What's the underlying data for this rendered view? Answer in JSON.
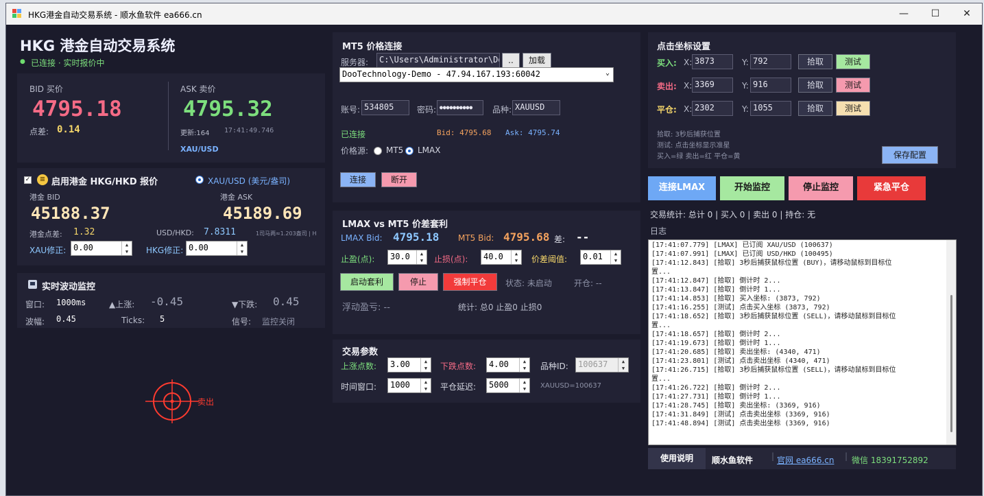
{
  "window": {
    "title": "HKG港金自动交易系统 - 顺水鱼软件 ea666.cn",
    "buttons": [
      "—",
      "☐",
      "✕"
    ]
  },
  "header": {
    "title": "HKG 港金自动交易系统",
    "status": "已连接 · 实时报价中"
  },
  "quote": {
    "bid_label": "BID 买价",
    "bid": "4795.18",
    "ask_label": "ASK 卖价",
    "ask": "4795.32",
    "spread_label": "点差:",
    "spread": "0.14",
    "update_label": "更新:164",
    "time": "17:41:49.746",
    "symbol": "XAU/USD"
  },
  "hkg": {
    "enable_label": "启用港金 HKG/HKD 报价",
    "radio_label": "XAU/USD (美元/盎司)",
    "bid_label": "港金 BID",
    "bid": "45188.37",
    "ask_label": "港金 ASK",
    "ask": "45189.69",
    "spread_label": "港金点差:",
    "spread": "1.32",
    "rate_label": "USD/HKD:",
    "rate": "7.8311",
    "rate_note": "1司马两≈1.203盎司 | H",
    "xau_adj_label": "XAU修正:",
    "xau_adj": "0.00",
    "hkg_adj_label": "HKG修正:",
    "hkg_adj": "0.00"
  },
  "monitor": {
    "title": "实时波动监控",
    "window_label": "窗口:",
    "window": "1000ms",
    "up_label": "▲上涨:",
    "up": "-0.45",
    "down_label": "▼下跌:",
    "down": "0.45",
    "amp_label": "波幅:",
    "amp": "0.45",
    "ticks_label": "Ticks:",
    "ticks": "5",
    "signal_label": "信号:",
    "signal": "监控关闭"
  },
  "crosshair": {
    "label": "卖出"
  },
  "mt5": {
    "title": "MT5 价格连接",
    "server_label": "服务器:",
    "server_path": "C:\\Users\\Administrator\\Do",
    "browse": "..",
    "load": "加载",
    "server_select": "DooTechnology-Demo - 47.94.167.193:60042",
    "account_label": "账号:",
    "account": "534805",
    "password_label": "密码:",
    "password": "●●●●●●●●●●",
    "symbol_label": "品种:",
    "symbol": "XAUUSD",
    "status": "已连接",
    "bid_text": "Bid: 4795.68",
    "ask_text": "Ask: 4795.74",
    "source_label": "价格源:",
    "source_mt5": "MT5",
    "source_lmax": "LMAX",
    "connect": "连接",
    "disconnect": "断开"
  },
  "arb": {
    "title": "LMAX vs MT5 价差套利",
    "lmax_bid_label": "LMAX Bid:",
    "lmax_bid": "4795.18",
    "mt5_bid_label": "MT5 Bid:",
    "mt5_bid": "4795.68",
    "diff_label": "差:",
    "diff": "--",
    "tp_label": "止盈(点):",
    "tp": "30.0",
    "sl_label": "止损(点):",
    "sl": "40.0",
    "threshold_label": "价差阈值:",
    "threshold": "0.01",
    "start": "启动套利",
    "stop": "停止",
    "force_close": "强制平仓",
    "state": "状态: 未启动",
    "open": "开仓: --",
    "pnl": "浮动盈亏: --",
    "stats": "统计: 总0 止盈0 止损0"
  },
  "params": {
    "title": "交易参数",
    "up_pts_label": "上涨点数:",
    "up_pts": "3.00",
    "down_pts_label": "下跌点数:",
    "down_pts": "4.00",
    "symbol_id_label": "品种ID:",
    "symbol_id": "100637",
    "time_window_label": "时间窗口:",
    "time_window": "1000",
    "close_delay_label": "平仓延迟:",
    "close_delay": "5000",
    "symbol_note": "XAUUSD=100637"
  },
  "coords": {
    "title": "点击坐标设置",
    "rows": [
      {
        "label": "买入:",
        "x": "3873",
        "y": "792",
        "pick": "拾取",
        "test": "测试",
        "color": "#a6e8a0"
      },
      {
        "label": "卖出:",
        "x": "3369",
        "y": "916",
        "pick": "拾取",
        "test": "测试",
        "color": "#f59aae"
      },
      {
        "label": "平仓:",
        "x": "2302",
        "y": "1055",
        "pick": "拾取",
        "test": "测试",
        "color": "#f5dfb0"
      }
    ],
    "x_label": "X:",
    "y_label": "Y:",
    "note1": "拾取: 3秒后捕获位置",
    "note2": "测试: 点击坐标显示准星",
    "note3": "买入=绿 卖出=红 平仓=黄",
    "save": "保存配置"
  },
  "actions": {
    "connect_lmax": "连接LMAX",
    "start_monitor": "开始监控",
    "stop_monitor": "停止监控",
    "emergency_close": "紧急平仓"
  },
  "stats_line": "交易统计: 总计 0 | 买入 0 | 卖出 0 | 持仓: 无",
  "log_title": "日志",
  "log": [
    "[17:41:07.779] [LMAX] 已订阅 XAU/USD (100637)",
    "[17:41:07.991] [LMAX] 已订阅 USD/HKD (100495)",
    "[17:41:12.843] [拾取] 3秒后捕获鼠标位置 (BUY)，请移动鼠标到目标位",
    "置...",
    "[17:41:12.847] [拾取] 倒计时 2...",
    "[17:41:13.847] [拾取] 倒计时 1...",
    "[17:41:14.853] [拾取] 买入坐标: (3873, 792)",
    "[17:41:16.255] [测试] 点击买入坐标 (3873, 792)",
    "[17:41:18.652] [拾取] 3秒后捕获鼠标位置 (SELL)，请移动鼠标到目标位",
    "置...",
    "[17:41:18.657] [拾取] 倒计时 2...",
    "[17:41:19.673] [拾取] 倒计时 1...",
    "[17:41:20.685] [拾取] 卖出坐标: (4340, 471)",
    "[17:41:23.801] [测试] 点击卖出坐标 (4340, 471)",
    "[17:41:26.715] [拾取] 3秒后捕获鼠标位置 (SELL)，请移动鼠标到目标位",
    "置...",
    "[17:41:26.722] [拾取] 倒计时 2...",
    "[17:41:27.731] [拾取] 倒计时 1...",
    "[17:41:28.745] [拾取] 卖出坐标: (3369, 916)",
    "[17:41:31.849] [测试] 点击卖出坐标 (3369, 916)",
    "[17:41:48.894] [测试] 点击卖出坐标 (3369, 916)"
  ],
  "footer": {
    "help": "使用说明",
    "brand": "顺水鱼软件",
    "site": "官网 ea666.cn",
    "wechat": "微信 18391752892"
  }
}
